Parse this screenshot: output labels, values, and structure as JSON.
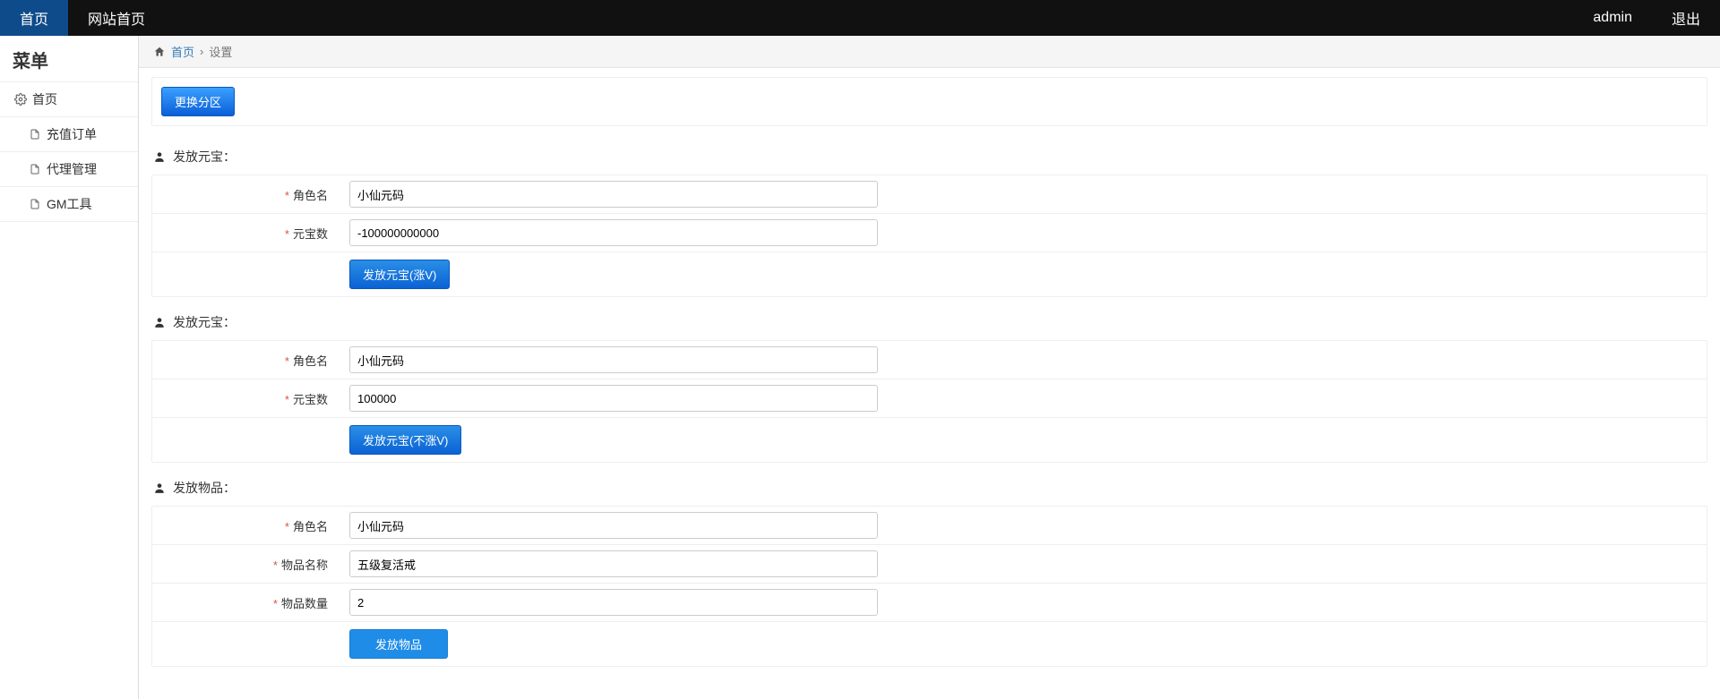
{
  "topbar": {
    "home": "首页",
    "site_home": "网站首页",
    "user": "admin",
    "logout": "退出"
  },
  "sidebar": {
    "title": "菜单",
    "home": "首页",
    "items": [
      "充值订单",
      "代理管理",
      "GM工具"
    ]
  },
  "breadcrumb": {
    "home": "首页",
    "current": "设置"
  },
  "top_button": "更换分区",
  "sections": [
    {
      "title": "发放元宝：",
      "fields": [
        {
          "label": "角色名",
          "value": "小仙元码"
        },
        {
          "label": "元宝数",
          "value": "-100000000000"
        }
      ],
      "submit": "发放元宝(涨V)"
    },
    {
      "title": "发放元宝：",
      "fields": [
        {
          "label": "角色名",
          "value": "小仙元码"
        },
        {
          "label": "元宝数",
          "value": "100000"
        }
      ],
      "submit": "发放元宝(不涨V)"
    },
    {
      "title": "发放物品：",
      "fields": [
        {
          "label": "角色名",
          "value": "小仙元码"
        },
        {
          "label": "物品名称",
          "value": "五级复活戒"
        },
        {
          "label": "物品数量",
          "value": "2"
        }
      ],
      "submit": "发放物品"
    }
  ]
}
